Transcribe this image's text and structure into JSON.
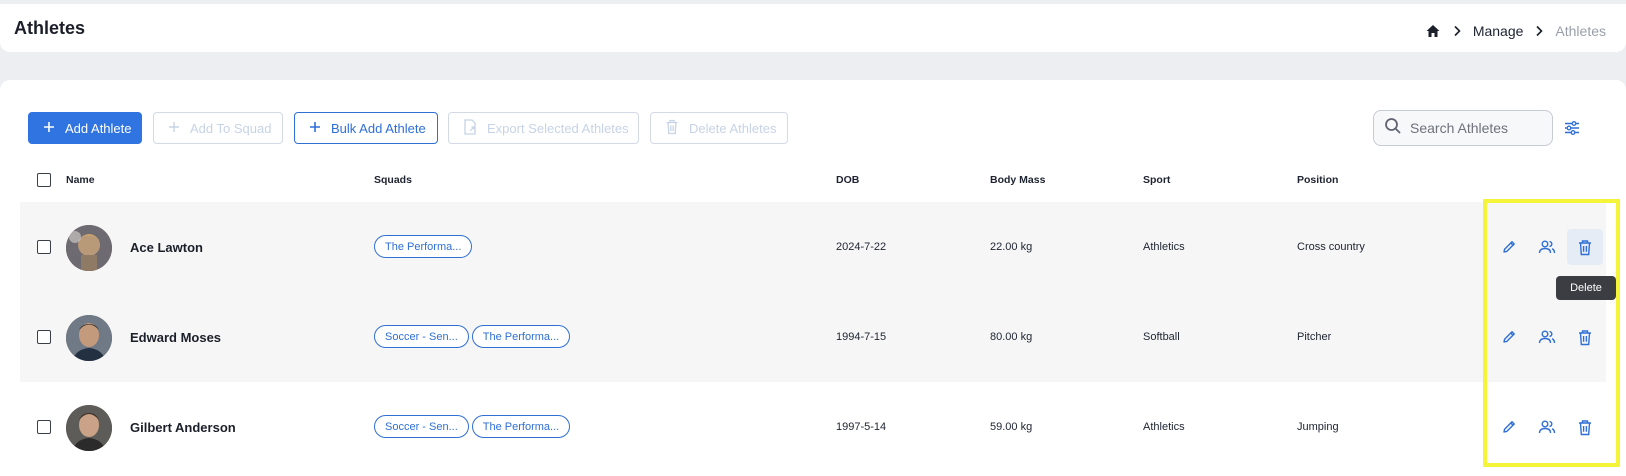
{
  "header": {
    "title": "Athletes",
    "breadcrumb": [
      {
        "label": "Manage"
      },
      {
        "label": "Athletes"
      }
    ]
  },
  "toolbar": {
    "add_athlete": "Add Athlete",
    "add_to_squad": "Add To Squad",
    "bulk_add_athlete": "Bulk Add Athlete",
    "export_selected": "Export Selected Athletes",
    "delete_athletes": "Delete Athletes"
  },
  "search": {
    "placeholder": "Search Athletes",
    "value": ""
  },
  "table": {
    "columns": {
      "name": "Name",
      "squads": "Squads",
      "dob": "DOB",
      "body_mass": "Body Mass",
      "sport": "Sport",
      "position": "Position"
    },
    "rows": [
      {
        "name": "Ace Lawton",
        "squads": [
          "The Performa..."
        ],
        "dob": "2024-7-22",
        "body_mass": "22.00 kg",
        "sport": "Athletics",
        "position": "Cross country"
      },
      {
        "name": "Edward Moses",
        "squads": [
          "Soccer - Sen...",
          "The Performa..."
        ],
        "dob": "1994-7-15",
        "body_mass": "80.00 kg",
        "sport": "Softball",
        "position": "Pitcher"
      },
      {
        "name": "Gilbert Anderson",
        "squads": [
          "Soccer - Sen...",
          "The Performa..."
        ],
        "dob": "1997-5-14",
        "body_mass": "59.00 kg",
        "sport": "Athletics",
        "position": "Jumping"
      }
    ]
  },
  "tooltip": {
    "text": "Delete"
  },
  "icons": {
    "edit": "pencil-icon",
    "squad": "people-icon",
    "delete": "trash-icon",
    "home": "home-icon",
    "search": "search-icon",
    "filter": "sliders-icon"
  },
  "colors": {
    "accent": "#2f74e0",
    "highlight": "#f6f43a"
  }
}
